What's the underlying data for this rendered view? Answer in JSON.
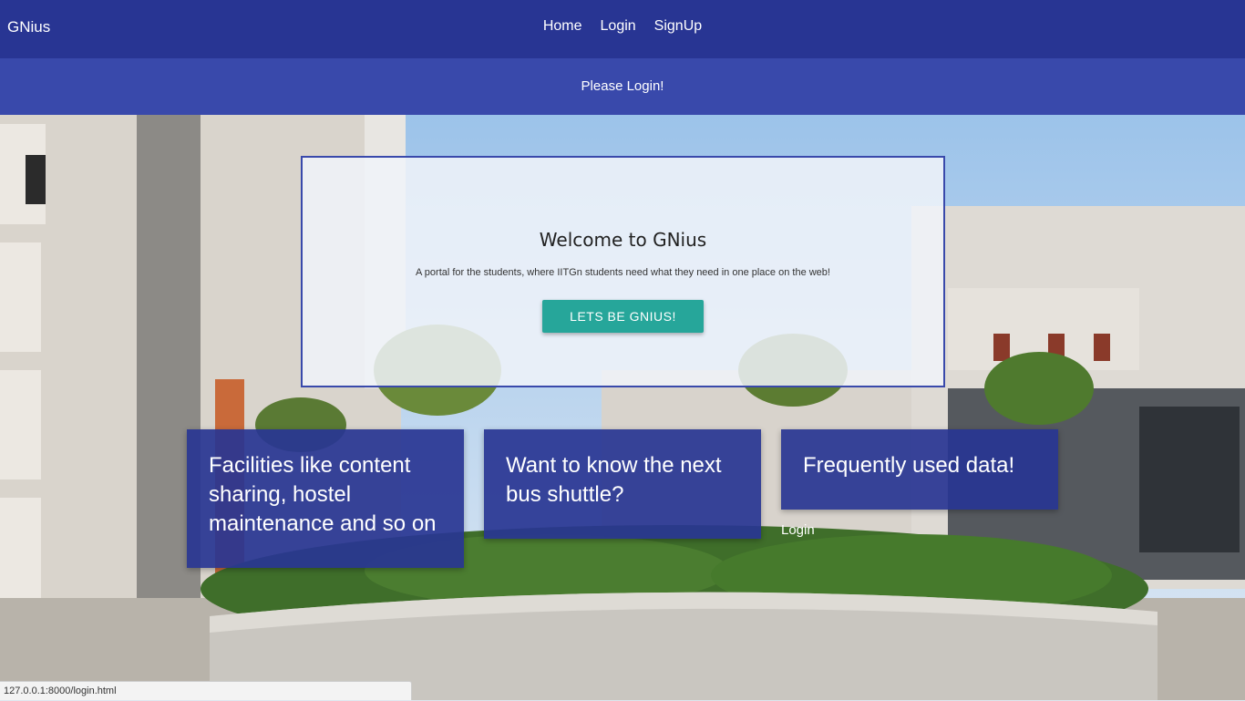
{
  "navbar": {
    "brand": "GNius",
    "links": [
      "Home",
      "Login",
      "SignUp"
    ]
  },
  "banner": {
    "text": "Please Login!"
  },
  "welcome": {
    "title": "Welcome to GNius",
    "subtitle": "A portal for the students, where IITGn students need what they need in one place on the web!",
    "button": "LETS BE GNIUS!"
  },
  "features": [
    "Facilities like content sharing, hostel maintenance and so on",
    "Want to know the next bus shuttle?",
    "Frequently used data!"
  ],
  "card_link": "Login",
  "statusbar": {
    "url": "127.0.0.1:8000/login.html"
  },
  "colors": {
    "navbar": "#283593",
    "banner": "#3949ab",
    "button": "#26a69a",
    "card": "#283593"
  }
}
